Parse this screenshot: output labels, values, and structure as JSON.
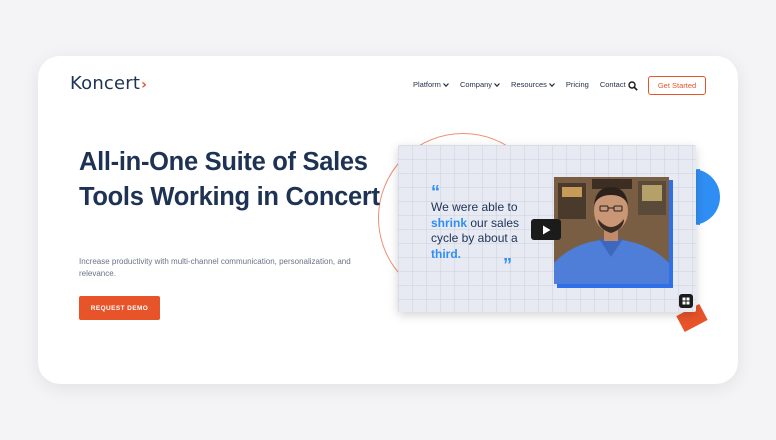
{
  "brand": {
    "logo_text": "Koncert",
    "logo_chevron": "›",
    "accent": "#e8542a",
    "navy": "#1e3354",
    "blue": "#2f8ef4"
  },
  "nav": {
    "items": [
      {
        "label": "Platform",
        "has_dropdown": true
      },
      {
        "label": "Company",
        "has_dropdown": true
      },
      {
        "label": "Resources",
        "has_dropdown": true
      },
      {
        "label": "Pricing",
        "has_dropdown": false
      },
      {
        "label": "Contact",
        "has_dropdown": false
      }
    ],
    "search_icon": "search-icon",
    "cta_label": "Get Started"
  },
  "hero": {
    "headline": "All-in-One Suite of Sales Tools Working in Concert",
    "subtext": "Increase productivity with multi-channel communication, personalization, and relevance.",
    "button_label": "REQUEST DEMO"
  },
  "video": {
    "quote_parts": [
      "We were able to ",
      "shrink",
      " our sales cycle by about a ",
      "third."
    ],
    "quote_open": "“",
    "quote_close": "”",
    "play_icon": "play-icon",
    "corner_icon": "grid-icon"
  }
}
